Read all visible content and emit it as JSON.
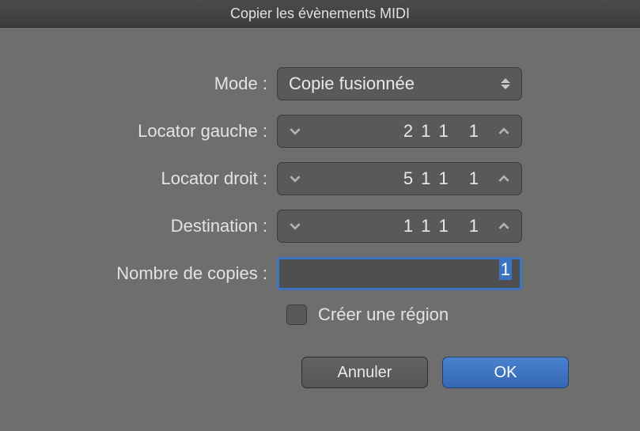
{
  "title": "Copier les évènements MIDI",
  "form": {
    "mode": {
      "label": "Mode :",
      "value": "Copie fusionnée"
    },
    "left_locator": {
      "label": "Locator gauche :",
      "value": "2 1 1",
      "value2": "1"
    },
    "right_locator": {
      "label": "Locator droit :",
      "value": "5 1 1",
      "value2": "1"
    },
    "destination": {
      "label": "Destination :",
      "value": "1 1 1",
      "value2": "1"
    },
    "copies": {
      "label": "Nombre de copies :",
      "value": "1"
    },
    "create_region": {
      "label": "Créer une région"
    }
  },
  "buttons": {
    "cancel": "Annuler",
    "ok": "OK"
  }
}
